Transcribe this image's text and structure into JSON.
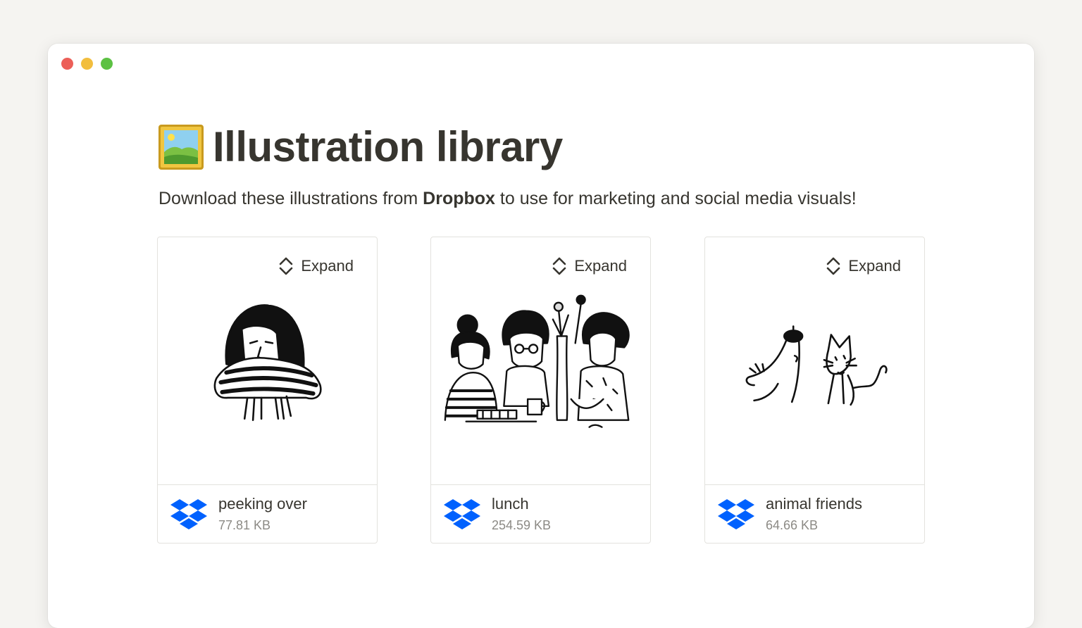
{
  "page": {
    "title": "Illustration library",
    "title_icon": "framed-picture-icon",
    "subtitle_prefix": "Download these illustrations from ",
    "subtitle_bold": "Dropbox",
    "subtitle_suffix": " to use for marketing and social media visuals!"
  },
  "cards": [
    {
      "expand_label": "Expand",
      "file_name": "peeking over",
      "file_size": "77.81 KB",
      "icon": "dropbox-icon"
    },
    {
      "expand_label": "Expand",
      "file_name": "lunch",
      "file_size": "254.59 KB",
      "icon": "dropbox-icon"
    },
    {
      "expand_label": "Expand",
      "file_name": "animal friends",
      "file_size": "64.66 KB",
      "icon": "dropbox-icon"
    }
  ],
  "colors": {
    "background": "#f5f4f1",
    "window": "#ffffff",
    "text": "#37352f",
    "muted_text": "#8c8a85",
    "border": "#e3e2de",
    "dropbox_blue": "#0061fe",
    "traffic_red": "#ec5f58",
    "traffic_yellow": "#f2be3e",
    "traffic_green": "#5cc143"
  }
}
